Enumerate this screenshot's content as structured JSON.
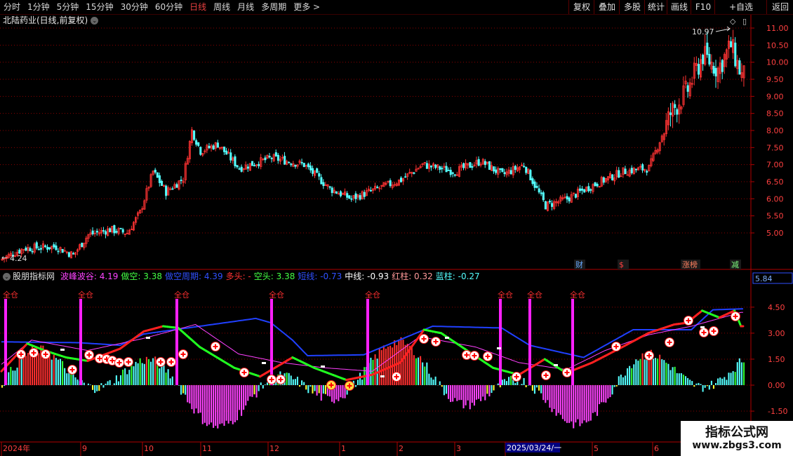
{
  "toolbar": {
    "periods": [
      "分时",
      "1分钟",
      "5分钟",
      "15分钟",
      "30分钟",
      "60分钟",
      "日线",
      "周线",
      "月线",
      "多周期",
      "更多 >"
    ],
    "active_index": 6,
    "right_buttons": [
      "复权",
      "叠加",
      "多股",
      "统计",
      "画线",
      "F10",
      "+自选",
      "返回"
    ]
  },
  "main_chart": {
    "title": "北陆药业(日线,前复权)",
    "high_label": "10.97",
    "low_label": "4.24",
    "price_ticks": [
      "11.00",
      "10.50",
      "10.00",
      "9.50",
      "9.00",
      "8.50",
      "8.00",
      "7.50",
      "7.00",
      "6.50",
      "6.00",
      "5.50",
      "5.00"
    ],
    "markers": [
      "财",
      "$",
      "涨榜",
      "减"
    ],
    "colors": {
      "up": "#ff3333",
      "down": "#54ffff",
      "grid": "#8b0000"
    }
  },
  "indicator": {
    "name": "股朋指标网",
    "fields": [
      {
        "label": "波峰波谷:",
        "value": "4.19",
        "color": "#ff44ff"
      },
      {
        "label": "做空:",
        "value": "3.38",
        "color": "#44ff44"
      },
      {
        "label": "做空周期:",
        "value": "4.39",
        "color": "#3050ff"
      },
      {
        "label": "多头:",
        "value": "-",
        "color": "#ff3333"
      },
      {
        "label": "空头:",
        "value": "3.38",
        "color": "#44ff44"
      },
      {
        "label": "短线:",
        "value": "-0.73",
        "color": "#3050ff"
      },
      {
        "label": "中线:",
        "value": "-0.93",
        "color": "#ffffff"
      },
      {
        "label": "红柱:",
        "value": "0.32",
        "color": "#ff9999"
      },
      {
        "label": "蓝柱:",
        "value": "-0.27",
        "color": "#54ffff"
      }
    ],
    "value_box": "5.84",
    "ticks": [
      "4.50",
      "3.00",
      "1.50",
      "0.00",
      "-1.50"
    ],
    "full_position_label": "全仓"
  },
  "time_axis": {
    "labels": [
      "2024年",
      "9",
      "10",
      "11",
      "12",
      "1",
      "2",
      "3",
      "2025/03/24/一",
      "5",
      "6"
    ]
  },
  "watermark": {
    "line1": "指标公式网",
    "line2": "www.zbgs3.com"
  }
}
